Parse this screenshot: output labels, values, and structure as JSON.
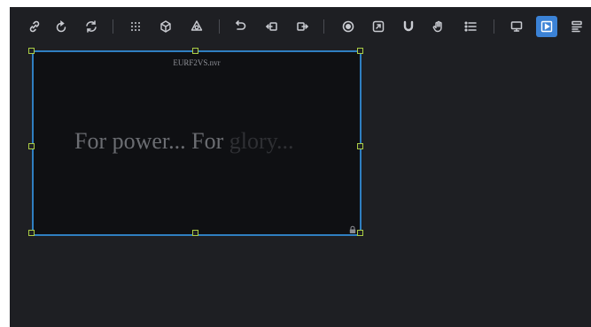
{
  "toolbar": {
    "groups": [
      [
        "link-icon",
        "rotate-icon",
        "refresh-icon"
      ],
      [
        "grid-icon",
        "cube-icon",
        "package-icon"
      ],
      [
        "undo-icon",
        "arrow-left-icon",
        "arrow-right-icon"
      ],
      [
        "gear-badge-icon",
        "resize-icon",
        "magnet-icon",
        "hand-icon",
        "list-icon"
      ],
      [
        "monitor-icon",
        "play-icon",
        "layers-icon"
      ]
    ],
    "active_icon": "play-icon",
    "active_color": "#3b82d6"
  },
  "canvas": {
    "frame": {
      "filename": "EURF2VS.nvr",
      "headline_part1": "For power... For",
      "headline_part2": "glory...",
      "selection_color": "#2f7fc1",
      "handle_color": "#aacc44"
    }
  }
}
